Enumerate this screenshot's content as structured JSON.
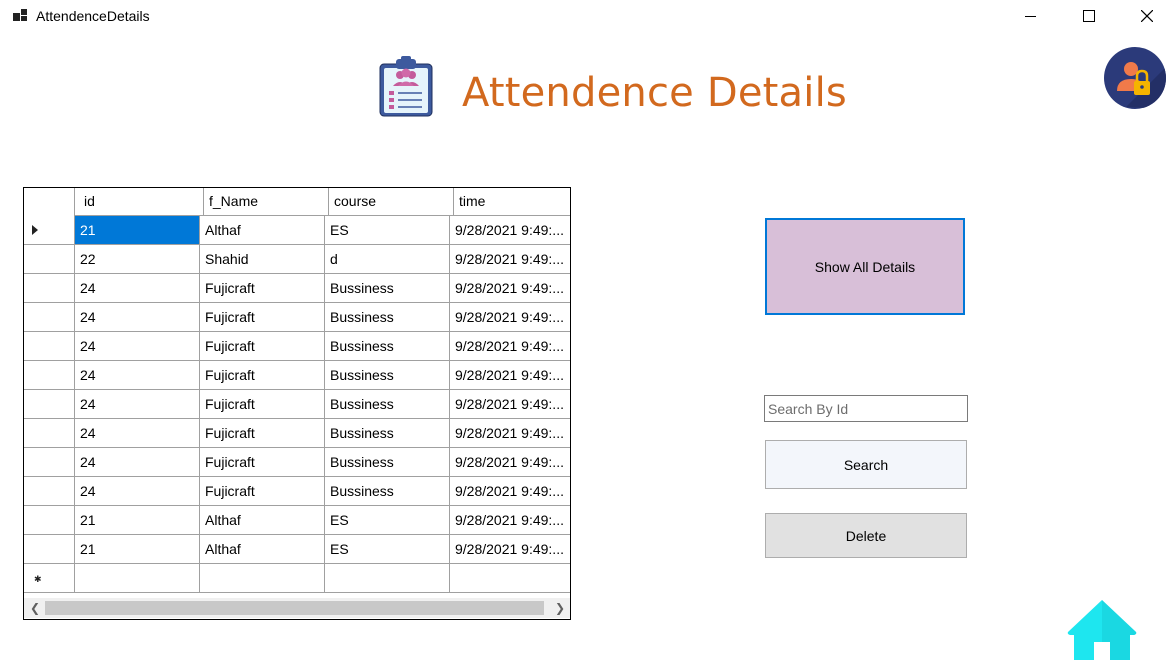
{
  "window": {
    "title": "AttendenceDetails"
  },
  "header": {
    "title": "Attendence Details",
    "title_color": "#d2691e"
  },
  "icons": {
    "app": "app-icon",
    "header": "clipboard-attendance-icon",
    "user_lock": "user-lock-icon",
    "home": "home-icon"
  },
  "grid": {
    "columns": [
      "id",
      "f_Name",
      "course",
      "time"
    ],
    "rows": [
      {
        "id": "21",
        "f_name": "Althaf",
        "course": "ES",
        "time": "9/28/2021 9:49:..."
      },
      {
        "id": "22",
        "f_name": "Shahid",
        "course": "d",
        "time": "9/28/2021 9:49:..."
      },
      {
        "id": "24",
        "f_name": "Fujicraft",
        "course": "Bussiness",
        "time": "9/28/2021 9:49:..."
      },
      {
        "id": "24",
        "f_name": "Fujicraft",
        "course": "Bussiness",
        "time": "9/28/2021 9:49:..."
      },
      {
        "id": "24",
        "f_name": "Fujicraft",
        "course": "Bussiness",
        "time": "9/28/2021 9:49:..."
      },
      {
        "id": "24",
        "f_name": "Fujicraft",
        "course": "Bussiness",
        "time": "9/28/2021 9:49:..."
      },
      {
        "id": "24",
        "f_name": "Fujicraft",
        "course": "Bussiness",
        "time": "9/28/2021 9:49:..."
      },
      {
        "id": "24",
        "f_name": "Fujicraft",
        "course": "Bussiness",
        "time": "9/28/2021 9:49:..."
      },
      {
        "id": "24",
        "f_name": "Fujicraft",
        "course": "Bussiness",
        "time": "9/28/2021 9:49:..."
      },
      {
        "id": "24",
        "f_name": "Fujicraft",
        "course": "Bussiness",
        "time": "9/28/2021 9:49:..."
      },
      {
        "id": "21",
        "f_name": "Althaf",
        "course": "ES",
        "time": "9/28/2021 9:49:..."
      },
      {
        "id": "21",
        "f_name": "Althaf",
        "course": "ES",
        "time": "9/28/2021 9:49:..."
      }
    ],
    "selected_row": 0,
    "selection_color": "#0078d7"
  },
  "actions": {
    "show_all_label": "Show All Details",
    "show_all_color": "#d8bfd8",
    "search_placeholder": "Search By Id",
    "search_value": "",
    "search_label": "Search",
    "delete_label": "Delete"
  },
  "colors": {
    "home_icon": "#1ee6ef",
    "user_lock_bg": "#2b3a7a"
  }
}
